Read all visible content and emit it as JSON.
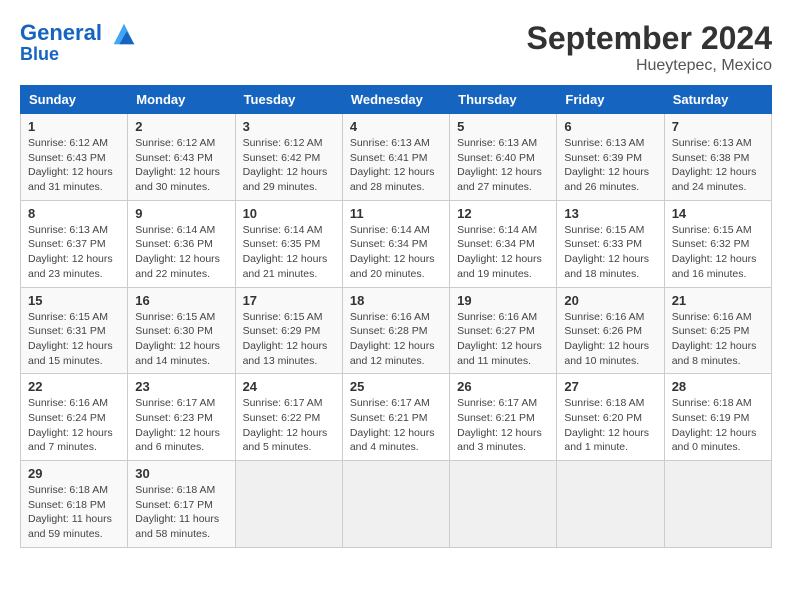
{
  "header": {
    "logo_line1": "General",
    "logo_line2": "Blue",
    "month": "September 2024",
    "location": "Hueytepec, Mexico"
  },
  "columns": [
    "Sunday",
    "Monday",
    "Tuesday",
    "Wednesday",
    "Thursday",
    "Friday",
    "Saturday"
  ],
  "weeks": [
    [
      {
        "day": "1",
        "info": "Sunrise: 6:12 AM\nSunset: 6:43 PM\nDaylight: 12 hours\nand 31 minutes."
      },
      {
        "day": "2",
        "info": "Sunrise: 6:12 AM\nSunset: 6:43 PM\nDaylight: 12 hours\nand 30 minutes."
      },
      {
        "day": "3",
        "info": "Sunrise: 6:12 AM\nSunset: 6:42 PM\nDaylight: 12 hours\nand 29 minutes."
      },
      {
        "day": "4",
        "info": "Sunrise: 6:13 AM\nSunset: 6:41 PM\nDaylight: 12 hours\nand 28 minutes."
      },
      {
        "day": "5",
        "info": "Sunrise: 6:13 AM\nSunset: 6:40 PM\nDaylight: 12 hours\nand 27 minutes."
      },
      {
        "day": "6",
        "info": "Sunrise: 6:13 AM\nSunset: 6:39 PM\nDaylight: 12 hours\nand 26 minutes."
      },
      {
        "day": "7",
        "info": "Sunrise: 6:13 AM\nSunset: 6:38 PM\nDaylight: 12 hours\nand 24 minutes."
      }
    ],
    [
      {
        "day": "8",
        "info": "Sunrise: 6:13 AM\nSunset: 6:37 PM\nDaylight: 12 hours\nand 23 minutes."
      },
      {
        "day": "9",
        "info": "Sunrise: 6:14 AM\nSunset: 6:36 PM\nDaylight: 12 hours\nand 22 minutes."
      },
      {
        "day": "10",
        "info": "Sunrise: 6:14 AM\nSunset: 6:35 PM\nDaylight: 12 hours\nand 21 minutes."
      },
      {
        "day": "11",
        "info": "Sunrise: 6:14 AM\nSunset: 6:34 PM\nDaylight: 12 hours\nand 20 minutes."
      },
      {
        "day": "12",
        "info": "Sunrise: 6:14 AM\nSunset: 6:34 PM\nDaylight: 12 hours\nand 19 minutes."
      },
      {
        "day": "13",
        "info": "Sunrise: 6:15 AM\nSunset: 6:33 PM\nDaylight: 12 hours\nand 18 minutes."
      },
      {
        "day": "14",
        "info": "Sunrise: 6:15 AM\nSunset: 6:32 PM\nDaylight: 12 hours\nand 16 minutes."
      }
    ],
    [
      {
        "day": "15",
        "info": "Sunrise: 6:15 AM\nSunset: 6:31 PM\nDaylight: 12 hours\nand 15 minutes."
      },
      {
        "day": "16",
        "info": "Sunrise: 6:15 AM\nSunset: 6:30 PM\nDaylight: 12 hours\nand 14 minutes."
      },
      {
        "day": "17",
        "info": "Sunrise: 6:15 AM\nSunset: 6:29 PM\nDaylight: 12 hours\nand 13 minutes."
      },
      {
        "day": "18",
        "info": "Sunrise: 6:16 AM\nSunset: 6:28 PM\nDaylight: 12 hours\nand 12 minutes."
      },
      {
        "day": "19",
        "info": "Sunrise: 6:16 AM\nSunset: 6:27 PM\nDaylight: 12 hours\nand 11 minutes."
      },
      {
        "day": "20",
        "info": "Sunrise: 6:16 AM\nSunset: 6:26 PM\nDaylight: 12 hours\nand 10 minutes."
      },
      {
        "day": "21",
        "info": "Sunrise: 6:16 AM\nSunset: 6:25 PM\nDaylight: 12 hours\nand 8 minutes."
      }
    ],
    [
      {
        "day": "22",
        "info": "Sunrise: 6:16 AM\nSunset: 6:24 PM\nDaylight: 12 hours\nand 7 minutes."
      },
      {
        "day": "23",
        "info": "Sunrise: 6:17 AM\nSunset: 6:23 PM\nDaylight: 12 hours\nand 6 minutes."
      },
      {
        "day": "24",
        "info": "Sunrise: 6:17 AM\nSunset: 6:22 PM\nDaylight: 12 hours\nand 5 minutes."
      },
      {
        "day": "25",
        "info": "Sunrise: 6:17 AM\nSunset: 6:21 PM\nDaylight: 12 hours\nand 4 minutes."
      },
      {
        "day": "26",
        "info": "Sunrise: 6:17 AM\nSunset: 6:21 PM\nDaylight: 12 hours\nand 3 minutes."
      },
      {
        "day": "27",
        "info": "Sunrise: 6:18 AM\nSunset: 6:20 PM\nDaylight: 12 hours\nand 1 minute."
      },
      {
        "day": "28",
        "info": "Sunrise: 6:18 AM\nSunset: 6:19 PM\nDaylight: 12 hours\nand 0 minutes."
      }
    ],
    [
      {
        "day": "29",
        "info": "Sunrise: 6:18 AM\nSunset: 6:18 PM\nDaylight: 11 hours\nand 59 minutes."
      },
      {
        "day": "30",
        "info": "Sunrise: 6:18 AM\nSunset: 6:17 PM\nDaylight: 11 hours\nand 58 minutes."
      },
      {
        "day": "",
        "info": ""
      },
      {
        "day": "",
        "info": ""
      },
      {
        "day": "",
        "info": ""
      },
      {
        "day": "",
        "info": ""
      },
      {
        "day": "",
        "info": ""
      }
    ]
  ]
}
